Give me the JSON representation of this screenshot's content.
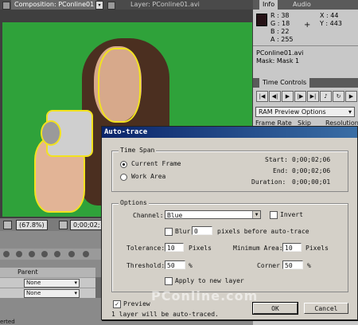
{
  "tabs": {
    "composition": "Composition: PConline01",
    "layer": "Layer: PConline01.avi"
  },
  "viewer": {
    "zoom": "(67.8%)",
    "timecode": "0;00;02;"
  },
  "timeline": {
    "parent_header": "Parent",
    "rows": [
      {
        "parent": "None"
      },
      {
        "parent": "None"
      }
    ],
    "status_fragment": "erted"
  },
  "info": {
    "tabs": [
      "Info",
      "Audio"
    ],
    "r": "R : 38",
    "g": "G : 18",
    "b": "B : 22",
    "a": "A : 255",
    "x": "X : 44",
    "y": "Y : 443",
    "file": "PConline01.avi",
    "mask": "Mask: Mask 1",
    "swatch_color": "#261216"
  },
  "time_controls": {
    "tab": "Time Controls",
    "ram_preview": "RAM Preview Options",
    "frame_rate": "Frame Rate",
    "skip": "Skip",
    "resolution": "Resolution"
  },
  "dialog": {
    "title": "Auto-trace",
    "time_span": {
      "legend": "Time Span",
      "current_frame": "Current Frame",
      "work_area": "Work Area",
      "start_label": "Start:",
      "start_value": "0;00;02;06",
      "end_label": "End:",
      "end_value": "0;00;02;06",
      "duration_label": "Duration:",
      "duration_value": "0;00;00;01"
    },
    "options": {
      "legend": "Options",
      "channel_label": "Channel:",
      "channel_value": "Blue",
      "invert": "Invert",
      "blur_label": "Blur",
      "blur_value": "0",
      "blur_suffix": "pixels before auto-trace",
      "tolerance_label": "Tolerance:",
      "tolerance_value": "10",
      "tolerance_unit": "Pixels",
      "min_area_label": "Minimum Area:",
      "min_area_value": "10",
      "min_area_unit": "Pixels",
      "threshold_label": "Threshold:",
      "threshold_value": "50",
      "threshold_unit": "%",
      "corner_label": "Corner",
      "corner_value": "50",
      "corner_unit": "%",
      "apply_new_layer": "Apply to new layer"
    },
    "preview": "Preview",
    "status": "1 layer will be auto-traced.",
    "ok": "OK",
    "cancel": "Cancel"
  },
  "watermark": "PConline.com"
}
